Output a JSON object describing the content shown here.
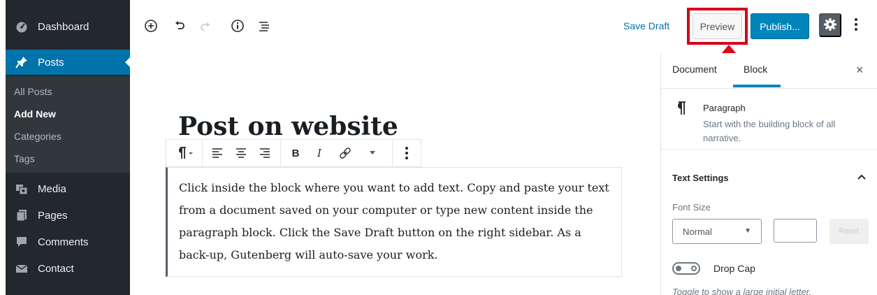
{
  "sidebar": {
    "items": [
      {
        "label": "Dashboard",
        "icon": "dashboard-icon"
      },
      {
        "label": "Posts",
        "icon": "pin-icon",
        "active": true
      },
      {
        "label": "Media",
        "icon": "media-icon"
      },
      {
        "label": "Pages",
        "icon": "pages-icon"
      },
      {
        "label": "Comments",
        "icon": "comment-icon"
      },
      {
        "label": "Contact",
        "icon": "mail-icon"
      }
    ],
    "submenu": [
      "All Posts",
      "Add New",
      "Categories",
      "Tags"
    ],
    "current_sub": "Add New"
  },
  "toolbar": {
    "icons": [
      "add-block-icon",
      "undo-icon",
      "redo-icon",
      "info-icon",
      "outline-icon"
    ],
    "save_draft": "Save Draft",
    "preview": "Preview",
    "publish": "Publish...",
    "settings_icon": "gear-icon",
    "more_icon": "more-vertical-icon"
  },
  "editor": {
    "title": "Post on website",
    "block_toolbar": {
      "bold": "B",
      "italic": "I"
    },
    "paragraph": "Click inside the block where you want to add text. Copy and paste your text from a document saved on your computer or type new content inside the paragraph block. Click the Save Draft button on the right sidebar. As a back-up, Gutenberg will auto-save your work."
  },
  "panel": {
    "tabs": [
      "Document",
      "Block"
    ],
    "active_tab": "Block",
    "close": "×",
    "block_card": {
      "title": "Paragraph",
      "description": "Start with the building block of all narrative."
    },
    "text_settings": {
      "header": "Text Settings",
      "font_size_label": "Font Size",
      "font_size_value": "Normal",
      "custom_size_value": "",
      "reset": "Reset",
      "drop_cap_label": "Drop Cap",
      "drop_cap_help": "Toggle to show a large initial letter."
    }
  },
  "colors": {
    "sidebar_bg": "#23282d",
    "active_bg": "#0073aa",
    "primary_button": "#0085ba",
    "highlight_red": "#d6001c"
  }
}
